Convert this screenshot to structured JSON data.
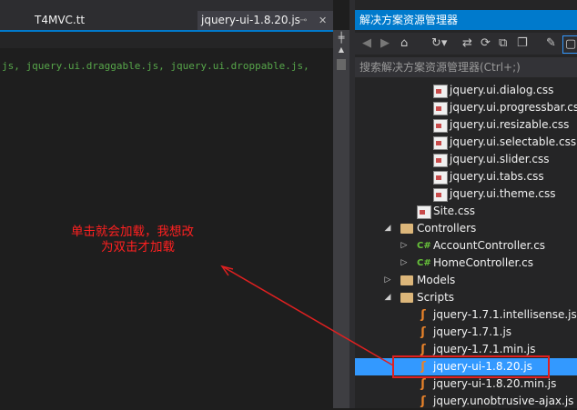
{
  "editor": {
    "tabs": [
      {
        "label": "T4MVC.tt"
      },
      {
        "label": "jquery-ui-1.8.20.js",
        "pin_icon": "pin-icon",
        "close_icon": "close-icon"
      }
    ],
    "code_line": "js, jquery.ui.draggable.js, jquery.ui.droppable.js,",
    "annotation": {
      "line1": "单击就会加载，我想改",
      "line2": "为双击才加载",
      "color": "#ff2020"
    }
  },
  "solution_explorer": {
    "title": "解决方案资源管理器",
    "search_placeholder": "搜索解决方案资源管理器(Ctrl+;)",
    "tree": [
      {
        "label": "jquery.ui.dialog.css",
        "type": "css"
      },
      {
        "label": "jquery.ui.progressbar.css",
        "type": "css"
      },
      {
        "label": "jquery.ui.resizable.css",
        "type": "css"
      },
      {
        "label": "jquery.ui.selectable.css",
        "type": "css"
      },
      {
        "label": "jquery.ui.slider.css",
        "type": "css"
      },
      {
        "label": "jquery.ui.tabs.css",
        "type": "css"
      },
      {
        "label": "jquery.ui.theme.css",
        "type": "css"
      },
      {
        "label": "Site.css",
        "type": "css"
      },
      {
        "label": "Controllers",
        "type": "folder",
        "expanded": true
      },
      {
        "label": "AccountController.cs",
        "type": "cs"
      },
      {
        "label": "HomeController.cs",
        "type": "cs"
      },
      {
        "label": "Models",
        "type": "folder",
        "expanded": false
      },
      {
        "label": "Scripts",
        "type": "folder",
        "expanded": true
      },
      {
        "label": "jquery-1.7.1.intellisense.js",
        "type": "js"
      },
      {
        "label": "jquery-1.7.1.js",
        "type": "js"
      },
      {
        "label": "jquery-1.7.1.min.js",
        "type": "js"
      },
      {
        "label": "jquery-ui-1.8.20.js",
        "type": "js",
        "selected": true
      },
      {
        "label": "jquery-ui-1.8.20.min.js",
        "type": "js"
      },
      {
        "label": "jquery.unobtrusive-ajax.js",
        "type": "js"
      }
    ],
    "selection_color": "#3399ff",
    "accent": "#007acc"
  }
}
